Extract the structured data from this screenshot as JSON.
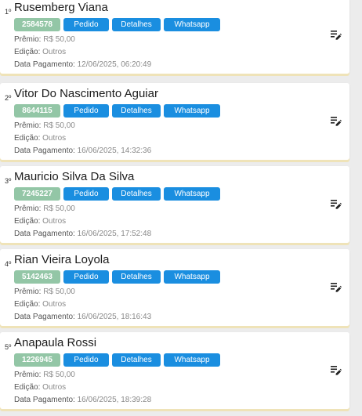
{
  "labels": {
    "premio": "Prêmio:",
    "edicao": "Edição:",
    "data_pagamento": "Data Pagamento:",
    "pedido": "Pedido",
    "detalhes": "Detalhes",
    "whatsapp": "Whatsapp"
  },
  "colors": {
    "order_badge": "#93c6a6",
    "action_button": "#1a8ee0",
    "card_shadow": "#efe3b8"
  },
  "winners": [
    {
      "rank": "1º",
      "name": "Rusemberg Viana",
      "order_number": "2584578",
      "premio": "R$ 50,00",
      "edicao": "Outros",
      "data_pagamento": "12/06/2025, 06:20:49"
    },
    {
      "rank": "2º",
      "name": "Vitor Do Nascimento Aguiar",
      "order_number": "8644115",
      "premio": "R$ 50,00",
      "edicao": "Outros",
      "data_pagamento": "16/06/2025, 14:32:36"
    },
    {
      "rank": "3º",
      "name": "Mauricio Silva Da Silva",
      "order_number": "7245227",
      "premio": "R$ 50,00",
      "edicao": "Outros",
      "data_pagamento": "16/06/2025, 17:52:48"
    },
    {
      "rank": "4º",
      "name": "Rian Vieira Loyola",
      "order_number": "5142463",
      "premio": "R$ 50,00",
      "edicao": "Outros",
      "data_pagamento": "16/06/2025, 18:16:43"
    },
    {
      "rank": "5º",
      "name": "Anapaula Rossi",
      "order_number": "1226945",
      "premio": "R$ 50,00",
      "edicao": "Outros",
      "data_pagamento": "16/06/2025, 18:39:28"
    }
  ]
}
